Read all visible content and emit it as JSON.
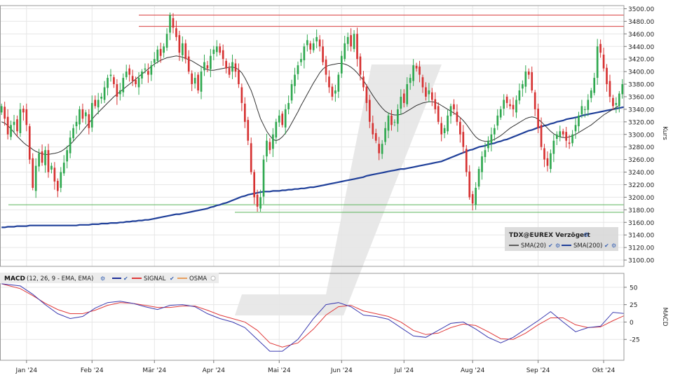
{
  "chart_data": [
    {
      "type": "candlestick",
      "instrument": "TDX@EUREX Verzögert",
      "ylabel": "Kurs",
      "ylim": [
        3090,
        3505
      ],
      "yticks": [
        3100,
        3120,
        3140,
        3160,
        3180,
        3200,
        3220,
        3240,
        3260,
        3280,
        3300,
        3320,
        3340,
        3360,
        3380,
        3400,
        3420,
        3440,
        3460,
        3480,
        3500
      ],
      "ytick_labels": [
        "3100.00",
        "3120.00",
        "3140.00",
        "3160.00",
        "3180.00",
        "3200.00",
        "3220.00",
        "3240.00",
        "3260.00",
        "3280.00",
        "3300.00",
        "3320.00",
        "3340.00",
        "3360.00",
        "3380.00",
        "3400.00",
        "3420.00",
        "3440.00",
        "3460.00",
        "3480.00",
        "3500.00"
      ],
      "x_months": [
        {
          "label": "Jan '24",
          "index": 8
        },
        {
          "label": "Feb '24",
          "index": 29
        },
        {
          "label": "Mär '24",
          "index": 49
        },
        {
          "label": "Apr '24",
          "index": 68
        },
        {
          "label": "Mai '24",
          "index": 89
        },
        {
          "label": "Jun '24",
          "index": 109
        },
        {
          "label": "Jul '24",
          "index": 129
        },
        {
          "label": "Aug '24",
          "index": 151
        },
        {
          "label": "Sep '24",
          "index": 172
        },
        {
          "label": "Okt '24",
          "index": 193
        }
      ],
      "closes": [
        3345,
        3325,
        3300,
        3315,
        3320,
        3305,
        3340,
        3335,
        3315,
        3260,
        3215,
        3250,
        3270,
        3255,
        3275,
        3240,
        3250,
        3225,
        3210,
        3240,
        3255,
        3275,
        3295,
        3310,
        3320,
        3340,
        3325,
        3335,
        3310,
        3350,
        3345,
        3355,
        3360,
        3375,
        3390,
        3395,
        3380,
        3360,
        3370,
        3390,
        3400,
        3395,
        3385,
        3380,
        3390,
        3400,
        3405,
        3395,
        3410,
        3420,
        3435,
        3425,
        3440,
        3460,
        3490,
        3470,
        3455,
        3430,
        3445,
        3420,
        3400,
        3380,
        3390,
        3370,
        3400,
        3415,
        3405,
        3425,
        3435,
        3440,
        3430,
        3420,
        3405,
        3395,
        3415,
        3400,
        3380,
        3350,
        3320,
        3290,
        3240,
        3200,
        3185,
        3200,
        3260,
        3290,
        3275,
        3300,
        3320,
        3330,
        3315,
        3340,
        3350,
        3380,
        3395,
        3410,
        3420,
        3440,
        3450,
        3435,
        3445,
        3455,
        3440,
        3415,
        3395,
        3375,
        3360,
        3370,
        3395,
        3425,
        3445,
        3455,
        3440,
        3460,
        3420,
        3395,
        3375,
        3350,
        3320,
        3300,
        3290,
        3270,
        3285,
        3310,
        3330,
        3315,
        3320,
        3340,
        3360,
        3350,
        3380,
        3390,
        3410,
        3405,
        3395,
        3375,
        3360,
        3370,
        3355,
        3340,
        3320,
        3300,
        3310,
        3330,
        3345,
        3340,
        3320,
        3300,
        3280,
        3240,
        3200,
        3190,
        3215,
        3245,
        3265,
        3275,
        3290,
        3300,
        3310,
        3330,
        3340,
        3355,
        3350,
        3345,
        3340,
        3355,
        3370,
        3380,
        3400,
        3395,
        3370,
        3340,
        3310,
        3280,
        3260,
        3250,
        3270,
        3290,
        3300,
        3305,
        3300,
        3290,
        3285,
        3300,
        3315,
        3330,
        3345,
        3340,
        3355,
        3370,
        3390,
        3440,
        3430,
        3405,
        3380,
        3360,
        3345,
        3350,
        3365,
        3380
      ],
      "sma20": [
        3320,
        3318,
        3314,
        3309,
        3303,
        3297,
        3292,
        3287,
        3283,
        3280,
        3276,
        3273,
        3271,
        3269,
        3268,
        3268,
        3269,
        3270,
        3271,
        3273,
        3276,
        3280,
        3284,
        3289,
        3295,
        3300,
        3306,
        3312,
        3318,
        3324,
        3330,
        3335,
        3340,
        3345,
        3350,
        3355,
        3360,
        3364,
        3368,
        3372,
        3376,
        3380,
        3384,
        3388,
        3392,
        3396,
        3400,
        3404,
        3408,
        3412,
        3415,
        3418,
        3420,
        3422,
        3423,
        3424,
        3425,
        3424,
        3423,
        3421,
        3419,
        3417,
        3414,
        3411,
        3408,
        3405,
        3403,
        3402,
        3402,
        3403,
        3404,
        3405,
        3406,
        3407,
        3407,
        3406,
        3403,
        3398,
        3390,
        3380,
        3370,
        3356,
        3340,
        3325,
        3315,
        3305,
        3298,
        3292,
        3290,
        3292,
        3296,
        3302,
        3309,
        3318,
        3327,
        3336,
        3346,
        3355,
        3364,
        3373,
        3382,
        3390,
        3398,
        3404,
        3408,
        3410,
        3411,
        3412,
        3413,
        3413,
        3412,
        3410,
        3407,
        3403,
        3398,
        3392,
        3386,
        3378,
        3370,
        3362,
        3355,
        3348,
        3342,
        3337,
        3334,
        3332,
        3331,
        3331,
        3332,
        3334,
        3337,
        3340,
        3343,
        3346,
        3348,
        3350,
        3351,
        3352,
        3352,
        3351,
        3349,
        3346,
        3343,
        3340,
        3337,
        3334,
        3331,
        3327,
        3322,
        3316,
        3309,
        3302,
        3296,
        3292,
        3290,
        3289,
        3289,
        3290,
        3292,
        3295,
        3298,
        3302,
        3306,
        3310,
        3313,
        3316,
        3319,
        3322,
        3325,
        3327,
        3328,
        3327,
        3324,
        3320,
        3315,
        3310,
        3305,
        3301,
        3298,
        3296,
        3295,
        3295,
        3296,
        3298,
        3300,
        3303,
        3306,
        3309,
        3312,
        3315,
        3319,
        3323,
        3327,
        3331,
        3334,
        3337,
        3340,
        3343,
        3346
      ],
      "sma200": [
        3152,
        3152,
        3153,
        3153,
        3153,
        3154,
        3154,
        3154,
        3154,
        3155,
        3155,
        3155,
        3155,
        3155,
        3155,
        3155,
        3155,
        3155,
        3155,
        3155,
        3155,
        3155,
        3155,
        3155,
        3155,
        3156,
        3156,
        3156,
        3156,
        3157,
        3157,
        3157,
        3158,
        3158,
        3158,
        3159,
        3159,
        3159,
        3160,
        3160,
        3161,
        3161,
        3162,
        3162,
        3163,
        3163,
        3164,
        3164,
        3165,
        3166,
        3167,
        3168,
        3169,
        3170,
        3171,
        3172,
        3173,
        3173,
        3174,
        3175,
        3176,
        3177,
        3178,
        3179,
        3180,
        3181,
        3182,
        3184,
        3185,
        3187,
        3188,
        3190,
        3191,
        3193,
        3195,
        3197,
        3199,
        3201,
        3202,
        3204,
        3205,
        3206,
        3207,
        3208,
        3209,
        3209,
        3209,
        3210,
        3210,
        3210,
        3211,
        3211,
        3212,
        3212,
        3213,
        3213,
        3214,
        3214,
        3215,
        3216,
        3216,
        3217,
        3218,
        3219,
        3220,
        3221,
        3222,
        3223,
        3224,
        3225,
        3226,
        3227,
        3228,
        3229,
        3230,
        3231,
        3232,
        3234,
        3235,
        3236,
        3237,
        3238,
        3239,
        3240,
        3241,
        3242,
        3243,
        3244,
        3245,
        3245,
        3246,
        3247,
        3248,
        3249,
        3250,
        3251,
        3252,
        3253,
        3254,
        3255,
        3256,
        3257,
        3259,
        3261,
        3263,
        3265,
        3267,
        3269,
        3271,
        3273,
        3275,
        3276,
        3278,
        3280,
        3281,
        3282,
        3284,
        3285,
        3286,
        3288,
        3289,
        3291,
        3292,
        3294,
        3296,
        3298,
        3300,
        3302,
        3304,
        3306,
        3307,
        3309,
        3311,
        3312,
        3314,
        3315,
        3317,
        3318,
        3320,
        3321,
        3322,
        3324,
        3325,
        3326,
        3327,
        3328,
        3330,
        3331,
        3332,
        3333,
        3334,
        3335,
        3336,
        3337,
        3338,
        3339,
        3340,
        3341,
        3342,
        3343,
        3344,
        3345,
        3346,
        3347,
        3348
      ],
      "hlines_red": [
        3490,
        3472
      ],
      "hlines_green": [
        3188,
        3176
      ],
      "legend": [
        {
          "label": "SMA(20)",
          "color": "#333333"
        },
        {
          "label": "SMA(200)",
          "color": "#1f3f99"
        }
      ],
      "colors": {
        "up": "#2fa84f",
        "down": "#d63232",
        "sma20": "#333333",
        "sma200": "#1f3f99",
        "hline_red": "#d94040",
        "hline_green": "#5ab55a"
      }
    },
    {
      "type": "line",
      "title": "MACD",
      "params": "(12, 26, 9 - EMA, EMA)",
      "ylabel": "MACD",
      "ylim": [
        -55,
        70
      ],
      "yticks": [
        -25,
        0,
        25,
        50
      ],
      "ytick_labels": [
        "-25",
        "0",
        "25",
        "50"
      ],
      "series": [
        {
          "name": "MACD",
          "color": "#3b3bb0"
        },
        {
          "name": "SIGNAL",
          "color": "#e03a3a"
        },
        {
          "name": "OSMA",
          "color": "#e8a060"
        }
      ],
      "macd_points": [
        [
          0,
          55
        ],
        [
          6,
          52
        ],
        [
          10,
          40
        ],
        [
          14,
          25
        ],
        [
          18,
          12
        ],
        [
          22,
          5
        ],
        [
          26,
          8
        ],
        [
          30,
          20
        ],
        [
          34,
          28
        ],
        [
          38,
          30
        ],
        [
          42,
          27
        ],
        [
          46,
          22
        ],
        [
          50,
          18
        ],
        [
          54,
          24
        ],
        [
          58,
          25
        ],
        [
          62,
          22
        ],
        [
          66,
          12
        ],
        [
          70,
          5
        ],
        [
          74,
          0
        ],
        [
          78,
          -8
        ],
        [
          82,
          -25
        ],
        [
          86,
          -42
        ],
        [
          90,
          -42
        ],
        [
          95,
          -25
        ],
        [
          100,
          5
        ],
        [
          104,
          25
        ],
        [
          108,
          28
        ],
        [
          112,
          22
        ],
        [
          116,
          10
        ],
        [
          120,
          8
        ],
        [
          124,
          4
        ],
        [
          128,
          -8
        ],
        [
          132,
          -20
        ],
        [
          136,
          -22
        ],
        [
          140,
          -12
        ],
        [
          144,
          -2
        ],
        [
          148,
          0
        ],
        [
          152,
          -10
        ],
        [
          156,
          -22
        ],
        [
          160,
          -30
        ],
        [
          164,
          -22
        ],
        [
          168,
          -10
        ],
        [
          172,
          2
        ],
        [
          176,
          15
        ],
        [
          180,
          0
        ],
        [
          184,
          -14
        ],
        [
          188,
          -8
        ],
        [
          192,
          -6
        ],
        [
          196,
          14
        ],
        [
          200,
          12
        ],
        [
          204,
          10
        ],
        [
          206,
          12
        ]
      ],
      "signal_points": [
        [
          0,
          55
        ],
        [
          6,
          48
        ],
        [
          10,
          38
        ],
        [
          14,
          27
        ],
        [
          18,
          18
        ],
        [
          22,
          12
        ],
        [
          26,
          12
        ],
        [
          30,
          17
        ],
        [
          34,
          24
        ],
        [
          38,
          28
        ],
        [
          42,
          27
        ],
        [
          46,
          24
        ],
        [
          50,
          21
        ],
        [
          54,
          21
        ],
        [
          58,
          23
        ],
        [
          62,
          23
        ],
        [
          66,
          17
        ],
        [
          70,
          10
        ],
        [
          74,
          5
        ],
        [
          78,
          0
        ],
        [
          82,
          -12
        ],
        [
          86,
          -30
        ],
        [
          90,
          -36
        ],
        [
          95,
          -30
        ],
        [
          100,
          -10
        ],
        [
          104,
          10
        ],
        [
          108,
          22
        ],
        [
          112,
          24
        ],
        [
          116,
          16
        ],
        [
          120,
          12
        ],
        [
          124,
          8
        ],
        [
          128,
          0
        ],
        [
          132,
          -12
        ],
        [
          136,
          -18
        ],
        [
          140,
          -16
        ],
        [
          144,
          -8
        ],
        [
          148,
          -3
        ],
        [
          152,
          -5
        ],
        [
          156,
          -14
        ],
        [
          160,
          -24
        ],
        [
          164,
          -25
        ],
        [
          168,
          -16
        ],
        [
          172,
          -4
        ],
        [
          176,
          6
        ],
        [
          180,
          6
        ],
        [
          184,
          -4
        ],
        [
          188,
          -8
        ],
        [
          192,
          -7
        ],
        [
          196,
          2
        ],
        [
          200,
          10
        ],
        [
          204,
          11
        ],
        [
          206,
          11
        ]
      ]
    }
  ],
  "xticks": [
    "Jan '24",
    "Feb '24",
    "Mär '24",
    "Apr '24",
    "Mai '24",
    "Jun '24",
    "Jul '24",
    "Aug '24",
    "Sep '24",
    "Okt '24"
  ]
}
